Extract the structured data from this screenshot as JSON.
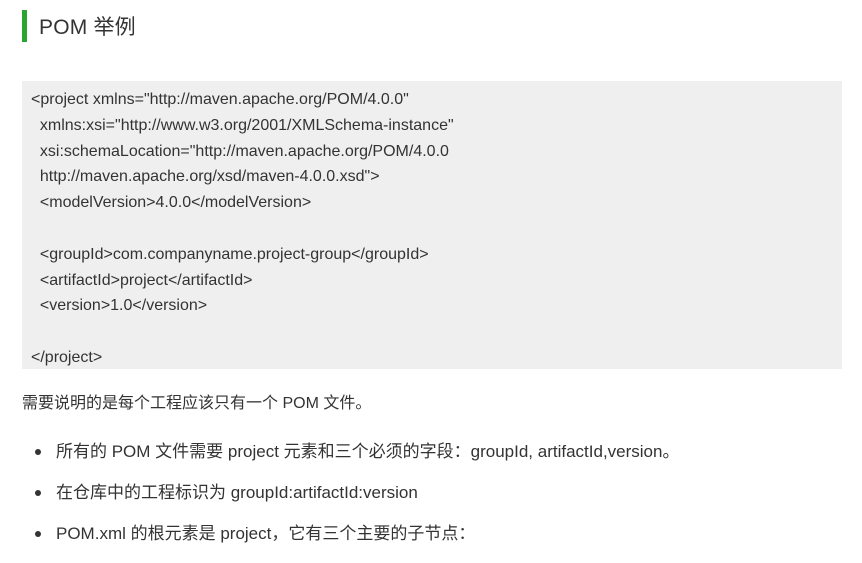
{
  "heading": {
    "title": "POM 举例",
    "accent_color": "#2aa52f"
  },
  "code": {
    "background_color": "#efefef",
    "lines": [
      "<project xmlns=\"http://maven.apache.org/POM/4.0.0\"",
      "  xmlns:xsi=\"http://www.w3.org/2001/XMLSchema-instance\"",
      "  xsi:schemaLocation=\"http://maven.apache.org/POM/4.0.0",
      "  http://maven.apache.org/xsd/maven-4.0.0.xsd\">",
      "  <modelVersion>4.0.0</modelVersion>",
      "",
      "  <groupId>com.companyname.project-group</groupId>",
      "  <artifactId>project</artifactId>",
      "  <version>1.0</version>",
      "",
      "</project>"
    ]
  },
  "note": "需要说明的是每个工程应该只有一个 POM 文件。",
  "bullets": [
    "所有的 POM 文件需要 project 元素和三个必须的字段：groupId, artifactId,version。",
    "在仓库中的工程标识为 groupId:artifactId:version",
    "POM.xml 的根元素是 project，它有三个主要的子节点："
  ]
}
